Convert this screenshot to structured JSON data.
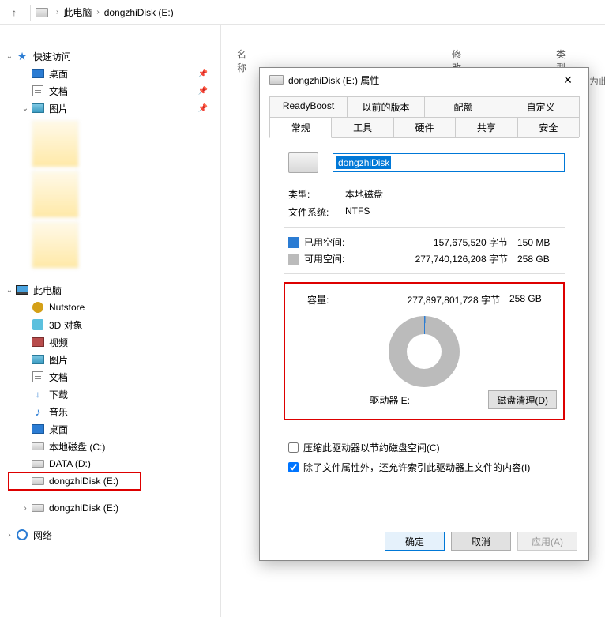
{
  "breadcrumb": {
    "segments": [
      "此电脑",
      "dongzhiDisk (E:)"
    ]
  },
  "columns": {
    "name": "名称",
    "modified": "修改日期",
    "type": "类型"
  },
  "partial_label": "为此",
  "sidebar": {
    "quick_access": "快速访问",
    "desktop": "桌面",
    "documents": "文档",
    "pictures": "图片",
    "this_pc": "此电脑",
    "nutstore": "Nutstore",
    "objects_3d": "3D 对象",
    "videos": "视频",
    "pictures2": "图片",
    "documents2": "文档",
    "downloads": "下载",
    "music": "音乐",
    "desktop2": "桌面",
    "local_disk_c": "本地磁盘 (C:)",
    "data_d": "DATA (D:)",
    "dongzhi_e_1": "dongzhiDisk (E:)",
    "dongzhi_e_2": "dongzhiDisk (E:)",
    "network": "网络"
  },
  "dialog": {
    "title": "dongzhiDisk (E:) 属性",
    "tabs_top": [
      "ReadyBoost",
      "以前的版本",
      "配额",
      "自定义"
    ],
    "tabs_bottom": [
      "常规",
      "工具",
      "硬件",
      "共享",
      "安全"
    ],
    "name_value": "dongzhiDisk",
    "type_label": "类型:",
    "type_value": "本地磁盘",
    "fs_label": "文件系统:",
    "fs_value": "NTFS",
    "used_label": "已用空间:",
    "used_bytes": "157,675,520 字节",
    "used_human": "150 MB",
    "free_label": "可用空间:",
    "free_bytes": "277,740,126,208 字节",
    "free_human": "258 GB",
    "capacity_label": "容量:",
    "capacity_bytes": "277,897,801,728 字节",
    "capacity_human": "258 GB",
    "drive_label": "驱动器 E:",
    "disk_cleanup": "磁盘清理(D)",
    "compress_label": "压缩此驱动器以节约磁盘空间(C)",
    "index_label": "除了文件属性外，还允许索引此驱动器上文件的内容(I)",
    "ok": "确定",
    "cancel": "取消",
    "apply": "应用(A)"
  }
}
